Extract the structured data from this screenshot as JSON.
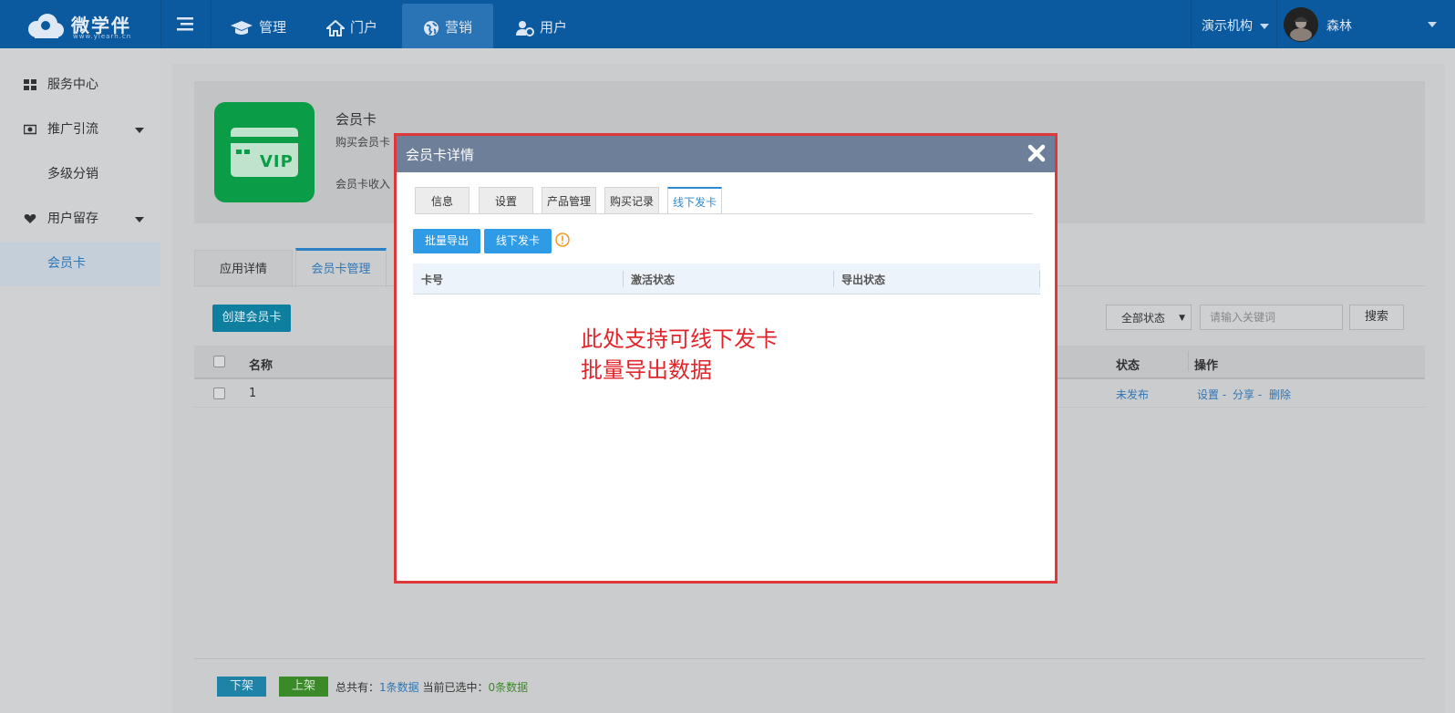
{
  "topbar": {
    "logo_text": "微学伴",
    "logo_sub": "www.ylearn.cn",
    "nav": [
      {
        "label": "管理",
        "icon": "graduation-cap-icon"
      },
      {
        "label": "门户",
        "icon": "home-icon"
      },
      {
        "label": "营销",
        "icon": "globe-icon"
      },
      {
        "label": "用户",
        "icon": "user-gear-icon"
      }
    ],
    "active_nav": "营销",
    "org": "演示机构",
    "username": "森林"
  },
  "sidebar": {
    "items": [
      {
        "label": "服务中心",
        "icon": "grid-icon"
      },
      {
        "label": "推广引流",
        "icon": "money-icon"
      },
      {
        "label": "多级分销",
        "icon": ""
      },
      {
        "label": "用户留存",
        "icon": "heart-icon"
      },
      {
        "label": "会员卡",
        "icon": ""
      }
    ],
    "active": "会员卡"
  },
  "header": {
    "title": "会员卡",
    "desc": "购买会员卡",
    "income": "会员卡收入",
    "vip_label": "VIP"
  },
  "content_tabs": [
    "应用详情",
    "会员卡管理"
  ],
  "toolbar": {
    "create_label": "创建会员卡",
    "status_select": "全部状态",
    "search_placeholder": "请输入关键词",
    "search_label": "搜索"
  },
  "table": {
    "headers": {
      "name": "名称",
      "status": "状态",
      "actions": "操作"
    },
    "rows": [
      {
        "name": "1",
        "status": "未发布",
        "actions": [
          "设置 -",
          "分享 -",
          "删除"
        ]
      }
    ]
  },
  "footer": {
    "down_label": "下架",
    "up_label": "上架",
    "total_prefix": "总共有：",
    "total_value": "1条数据",
    "selected_prefix": "当前已选中：",
    "selected_value": "0条数据"
  },
  "modal": {
    "title": "会员卡详情",
    "tabs": [
      "信息",
      "设置",
      "产品管理",
      "购买记录",
      "线下发卡"
    ],
    "active_tab": "线下发卡",
    "btn_export": "批量导出",
    "btn_issue": "线下发卡",
    "table_headers": [
      "卡号",
      "激活状态",
      "导出状态"
    ],
    "annotation": "此处支持可线下发卡\n批量导出数据"
  },
  "colors": {
    "topbar": "#0b5aa0",
    "accent": "#2f9be6",
    "annotation": "#e2252b",
    "modal_border": "#e0373b"
  }
}
